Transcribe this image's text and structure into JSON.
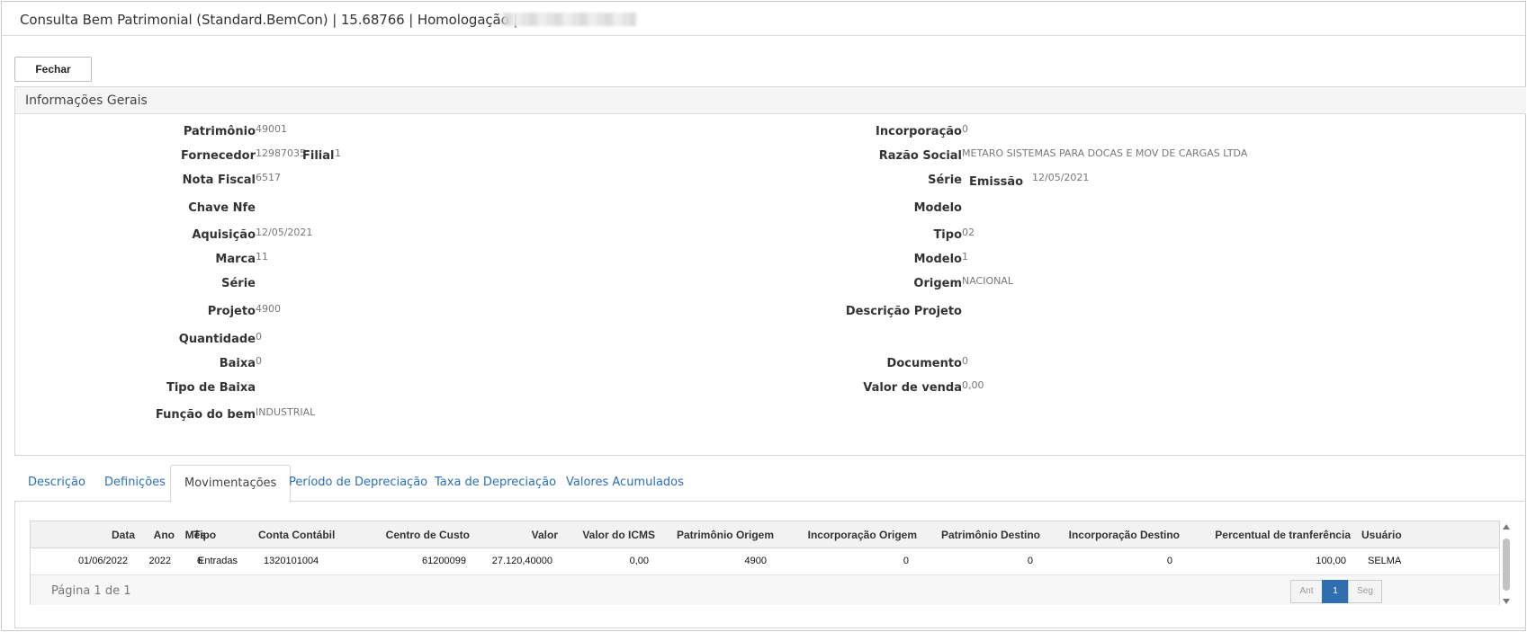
{
  "window": {
    "title": "Consulta Bem Patrimonial (Standard.BemCon) | 15.68766 | Homologação |"
  },
  "toolbar": {
    "close_label": "Fechar"
  },
  "general_info": {
    "title": "Informações Gerais",
    "left": [
      {
        "label": "Patrimônio",
        "value": "49001"
      },
      {
        "label": "Fornecedor",
        "value": "12987035"
      },
      {
        "label": "Nota Fiscal",
        "value": "6517"
      },
      {
        "label": "Chave Nfe",
        "value": ""
      },
      {
        "label": "Aquisição",
        "value": "12/05/2021"
      },
      {
        "label": "Marca",
        "value": "11"
      },
      {
        "label": "Série",
        "value": ""
      },
      {
        "label": "Projeto",
        "value": "4900"
      },
      {
        "label": "Quantidade",
        "value": "0"
      },
      {
        "label": "Baixa",
        "value": "0"
      },
      {
        "label": "Tipo de Baixa",
        "value": ""
      },
      {
        "label": "Função do bem",
        "value": "INDUSTRIAL"
      }
    ],
    "filial": {
      "label": "Filial",
      "value": "1"
    },
    "right": [
      {
        "label": "Incorporação",
        "value": "0"
      },
      {
        "label": "Razão Social",
        "value": "METARO SISTEMAS PARA DOCAS E MOV DE CARGAS LTDA"
      },
      {
        "label": "Série",
        "value": ""
      },
      {
        "label": "Modelo",
        "value": ""
      },
      {
        "label": "Tipo",
        "value": "02"
      },
      {
        "label": "Modelo",
        "value": "1"
      },
      {
        "label": "Origem",
        "value": "NACIONAL"
      },
      {
        "label": "Descrição Projeto",
        "value": ""
      },
      {
        "label": "Documento",
        "value": "0"
      },
      {
        "label": "Valor de venda",
        "value": "0,00"
      }
    ],
    "emissao": {
      "label": "Emissão",
      "value": "12/05/2021"
    }
  },
  "tabs": [
    {
      "label": "Descrição"
    },
    {
      "label": "Definições"
    },
    {
      "label": "Movimentações"
    },
    {
      "label": "Período de Depreciação"
    },
    {
      "label": "Taxa de Depreciação"
    },
    {
      "label": "Valores Acumulados"
    }
  ],
  "active_tab": "Movimentações",
  "movements": {
    "columns": [
      "Data",
      "Ano",
      "Mês",
      "Tipo",
      "Conta Contábil",
      "Centro de Custo",
      "Valor",
      "Valor do ICMS",
      "Patrimônio Origem",
      "Incorporação Origem",
      "Patrimônio Destino",
      "Incorporação Destino",
      "Percentual de tranferência",
      "Usuário"
    ],
    "rows": [
      [
        "01/06/2022",
        "2022",
        "6",
        "Entradas",
        "1320101004",
        "61200099",
        "27.120,40000",
        "0,00",
        "4900",
        "0",
        "0",
        "0",
        "100,00",
        "SELMA"
      ]
    ],
    "pager": {
      "info": "Página 1 de 1",
      "prev": "Ant",
      "current": "1",
      "next": "Seg"
    }
  },
  "colors": {
    "tab_link": "#2a6fb5",
    "pager_active": "#2f6fb0"
  }
}
